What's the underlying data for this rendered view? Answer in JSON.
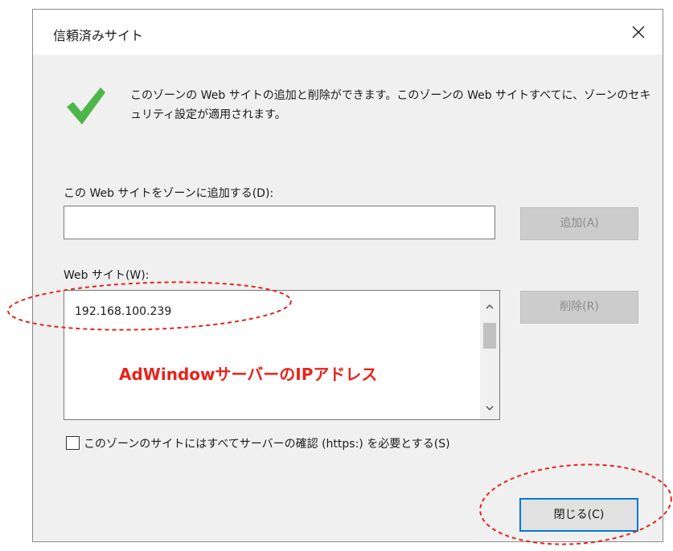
{
  "dialog": {
    "title": "信頼済みサイト",
    "close_icon": "close-icon"
  },
  "info": {
    "icon": "checkmark-icon",
    "text": "このゾーンの Web サイトの追加と削除ができます。このゾーンの Web サイトすべてに、ゾーンのセキュリティ設定が適用されます。"
  },
  "add_site": {
    "label": "この Web サイトをゾーンに追加する(D):",
    "value": "",
    "button_label": "追加(A)"
  },
  "sites": {
    "label": "Web サイト(W):",
    "items": [
      "192.168.100.239"
    ],
    "remove_label": "削除(R)"
  },
  "annotation": {
    "text": "AdWindowサーバーのIPアドレス",
    "color": "#e8231a"
  },
  "https_option": {
    "label": "このゾーンのサイトにはすべてサーバーの確認 (https:) を必要とする(S)",
    "checked": false
  },
  "footer": {
    "close_label": "閉じる(C)"
  },
  "colors": {
    "accent": "#0078d7",
    "check_green": "#4cb648",
    "callout_red": "#e8231a"
  }
}
